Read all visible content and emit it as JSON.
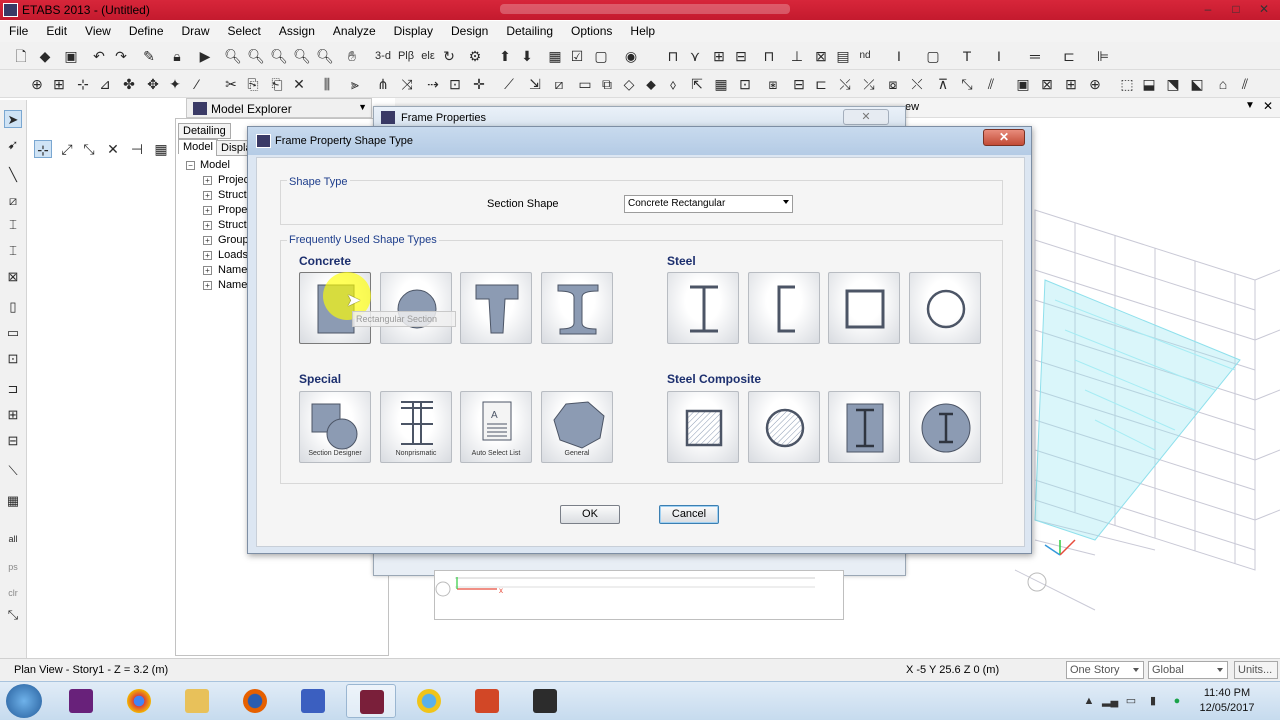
{
  "app": {
    "title": "ETABS 2013  - (Untitled)",
    "window_buttons": [
      "–",
      "□",
      "✕"
    ]
  },
  "menu": [
    "File",
    "Edit",
    "View",
    "Define",
    "Draw",
    "Select",
    "Assign",
    "Analyze",
    "Display",
    "Design",
    "Detailing",
    "Options",
    "Help"
  ],
  "toolbar": {
    "view_3d": "3-d",
    "plan": "Plβ",
    "elev": "elε",
    "nd": "nd"
  },
  "explorer": {
    "title": "Model Explorer",
    "tab_detailing": "Detailing",
    "tab_model": "Model",
    "tab_display": "Displa",
    "tree_root": "Model",
    "tree_items": [
      "Project",
      "Structu",
      "Proper",
      "Structu",
      "Groups",
      "Loads",
      "Named",
      "Named"
    ]
  },
  "view": {
    "tab_label": "ew"
  },
  "frame_properties": {
    "title": "Frame Properties",
    "close": "✕"
  },
  "dialog": {
    "title": "Frame Property Shape Type",
    "close": "✕",
    "shape_type_group": "Shape Type",
    "section_shape_label": "Section Shape",
    "section_shape_value": "Concrete Rectangular",
    "frequent_group": "Frequently Used Shape Types",
    "categories": {
      "concrete": "Concrete",
      "steel": "Steel",
      "special": "Special",
      "steel_composite": "Steel Composite"
    },
    "captions": {
      "section_designer": "Section Designer",
      "nonprismatic": "Nonprismatic",
      "auto_select": "Auto Select List",
      "general": "General"
    },
    "tooltip": "Rectangular Section",
    "ok": "OK",
    "cancel": "Cancel"
  },
  "status": {
    "left": "Plan View - Story1 - Z = 3.2 (m)",
    "coords": "X -5  Y 25.6  Z 0 (m)",
    "story": "One Story",
    "coord_system": "Global",
    "units": "Units..."
  },
  "taskbar": {
    "time": "11:40 PM",
    "date": "12/05/2017"
  }
}
